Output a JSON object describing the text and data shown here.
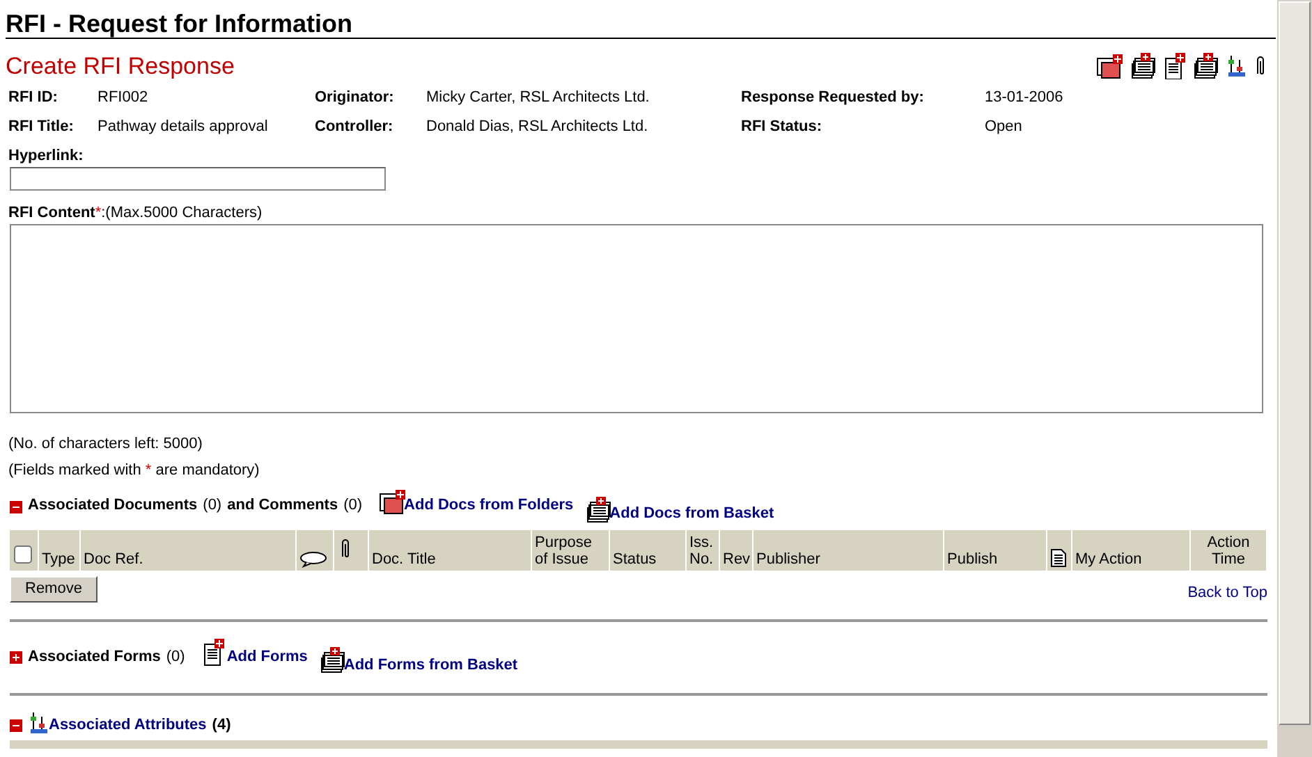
{
  "page_title": "RFI - Request for Information",
  "section_title": "Create RFI Response",
  "details": [
    {
      "label": "RFI ID:",
      "value": "RFI002"
    },
    {
      "label": "Originator:",
      "value": "Micky Carter, RSL Architects Ltd."
    },
    {
      "label": "Response Requested by:",
      "value": "13-01-2006"
    },
    {
      "label": "RFI Title:",
      "value": "Pathway details approval"
    },
    {
      "label": "Controller:",
      "value": "Donald Dias, RSL Architects Ltd."
    },
    {
      "label": "RFI Status:",
      "value": "Open"
    }
  ],
  "hyperlink": {
    "label": "Hyperlink:"
  },
  "content": {
    "label": "RFI Content",
    "required_mark": "*",
    "hint": ":(Max.5000 Characters)"
  },
  "chars_left": "(No. of characters left: 5000)",
  "mandatory_note": {
    "before": "(Fields marked with ",
    "mark": "*",
    "after": " are mandatory)"
  },
  "documents": {
    "expanded": true,
    "title": "Associated Documents",
    "count": "(0)",
    "title_2": "and Comments",
    "count_2": "(0)",
    "links": [
      {
        "label": "Add Docs from Folders",
        "kind": "folder"
      },
      {
        "label": "Add Docs from Basket",
        "kind": "basket"
      }
    ],
    "columns": [
      {
        "kind": "checkbox",
        "checked": false
      },
      {
        "kind": "text",
        "label": "Type"
      },
      {
        "kind": "text",
        "label": "Doc Ref."
      },
      {
        "kind": "comment"
      },
      {
        "kind": "clip"
      },
      {
        "kind": "text",
        "label": "Doc. Title"
      },
      {
        "kind": "text",
        "label": "Purpose of Issue"
      },
      {
        "kind": "text",
        "label": "Status"
      },
      {
        "kind": "text",
        "label": "Iss. No."
      },
      {
        "kind": "text",
        "label": "Rev"
      },
      {
        "kind": "text",
        "label": "Publisher"
      },
      {
        "kind": "text",
        "label": "Publish"
      },
      {
        "kind": "page"
      },
      {
        "kind": "text",
        "label": "My Action"
      },
      {
        "kind": "center",
        "label": "Action Time"
      }
    ],
    "remove_button": "Remove",
    "back_to_top": "Back to Top"
  },
  "forms": {
    "expanded": false,
    "title": "Associated Forms",
    "count": "(0)",
    "links": [
      {
        "label": "Add Forms",
        "kind": "form"
      },
      {
        "label": "Add Forms from Basket",
        "kind": "basket"
      }
    ]
  },
  "attributes": {
    "expanded": true,
    "title": "Associated Attributes",
    "count": "(4)"
  }
}
